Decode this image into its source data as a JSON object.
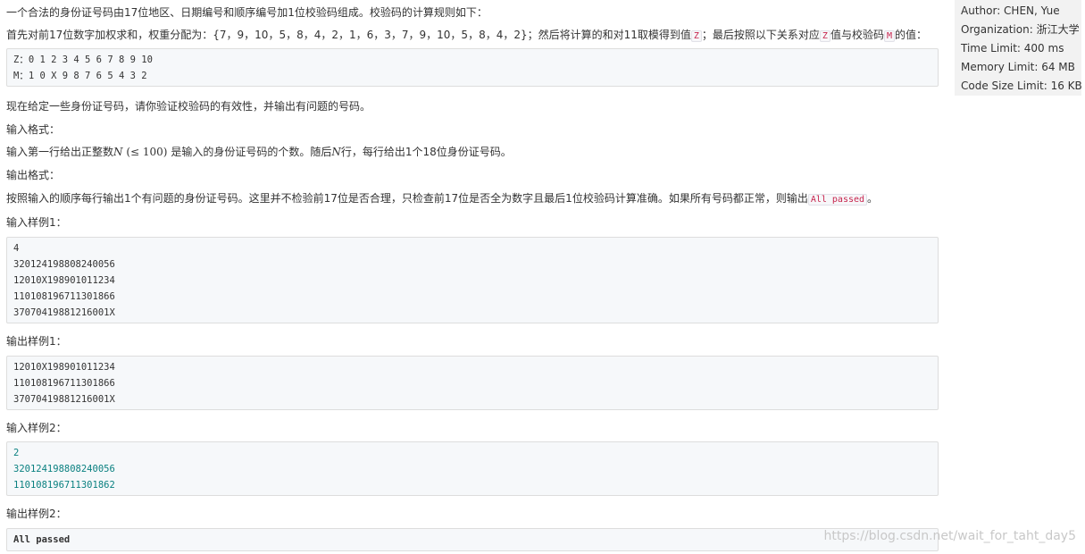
{
  "problem": {
    "intro": "一个合法的身份证号码由17位地区、日期编号和顺序编号加1位校验码组成。校验码的计算规则如下：",
    "rule_prefix": "首先对前17位数字加权求和，权重分配为：{7，9，10，5，8，4，2，1，6，3，7，9，10，5，8，4，2}；然后将计算的和对11取模得到值",
    "z_label": "Z",
    "rule_middle": "；最后按照以下关系对应",
    "rule_middle2": "值与校验码",
    "m_label": "M",
    "rule_suffix": "的值：",
    "mapping_lines": [
      "Z：0 1 2 3 4 5 6 7 8 9 10",
      "M：1 0 X 9 8 7 6 5 4 3 2"
    ],
    "task": "现在给定一些身份证号码，请你验证校验码的有效性，并输出有问题的号码。",
    "input_format_title": "输入格式：",
    "input_format_prefix": "输入第一行给出正整数",
    "input_var_n": "N",
    "input_constraint": "(≤ 100)",
    "input_format_middle": "是输入的身份证号码的个数。随后",
    "input_var_n2": "N",
    "input_format_suffix": "行，每行给出1个18位身份证号码。",
    "output_format_title": "输出格式：",
    "output_format_text": "按照输入的顺序每行输出1个有问题的身份证号码。这里并不检验前17位是否合理，只检查前17位是否全为数字且最后1位校验码计算准确。如果所有号码都正常，则输出",
    "all_passed": "All passed",
    "output_format_end": "。",
    "sample_input_1_title": "输入样例1：",
    "sample_input_1": [
      "4",
      "320124198808240056",
      "12010X198901011234",
      "110108196711301866",
      "37070419881216001X"
    ],
    "sample_output_1_title": "输出样例1：",
    "sample_output_1": [
      "12010X198901011234",
      "110108196711301866",
      "37070419881216001X"
    ],
    "sample_input_2_title": "输入样例2：",
    "sample_input_2": [
      "2",
      "320124198808240056",
      "110108196711301862"
    ],
    "sample_output_2_title": "输出样例2：",
    "sample_output_2": [
      "All passed"
    ]
  },
  "sidebar": {
    "author": "Author: CHEN, Yue",
    "organization": "Organization: 浙江大学",
    "time_limit": "Time Limit: 400 ms",
    "memory_limit": "Memory Limit: 64 MB",
    "code_size_limit": "Code Size Limit: 16 KB"
  },
  "watermark": "https://blog.csdn.net/wait_for_taht_day5"
}
